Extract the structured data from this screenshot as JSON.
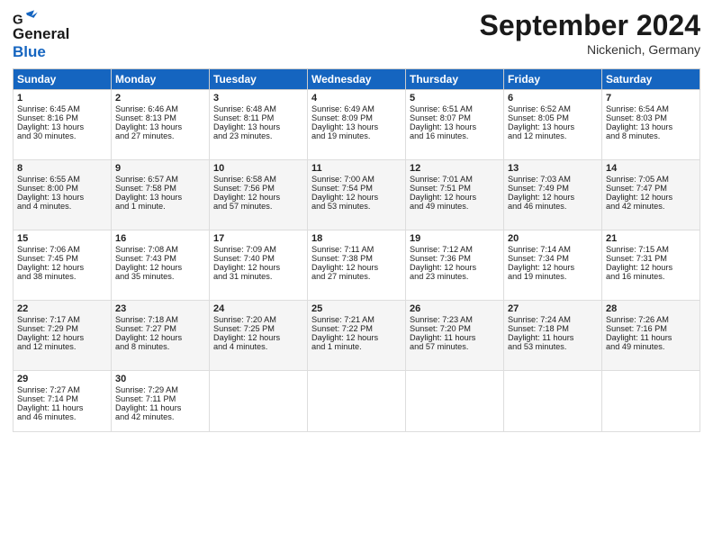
{
  "header": {
    "logo_line1": "General",
    "logo_line2": "Blue",
    "month": "September 2024",
    "location": "Nickenich, Germany"
  },
  "weekdays": [
    "Sunday",
    "Monday",
    "Tuesday",
    "Wednesday",
    "Thursday",
    "Friday",
    "Saturday"
  ],
  "weeks": [
    [
      {
        "day": 1,
        "lines": [
          "Sunrise: 6:45 AM",
          "Sunset: 8:16 PM",
          "Daylight: 13 hours",
          "and 30 minutes."
        ]
      },
      {
        "day": 2,
        "lines": [
          "Sunrise: 6:46 AM",
          "Sunset: 8:13 PM",
          "Daylight: 13 hours",
          "and 27 minutes."
        ]
      },
      {
        "day": 3,
        "lines": [
          "Sunrise: 6:48 AM",
          "Sunset: 8:11 PM",
          "Daylight: 13 hours",
          "and 23 minutes."
        ]
      },
      {
        "day": 4,
        "lines": [
          "Sunrise: 6:49 AM",
          "Sunset: 8:09 PM",
          "Daylight: 13 hours",
          "and 19 minutes."
        ]
      },
      {
        "day": 5,
        "lines": [
          "Sunrise: 6:51 AM",
          "Sunset: 8:07 PM",
          "Daylight: 13 hours",
          "and 16 minutes."
        ]
      },
      {
        "day": 6,
        "lines": [
          "Sunrise: 6:52 AM",
          "Sunset: 8:05 PM",
          "Daylight: 13 hours",
          "and 12 minutes."
        ]
      },
      {
        "day": 7,
        "lines": [
          "Sunrise: 6:54 AM",
          "Sunset: 8:03 PM",
          "Daylight: 13 hours",
          "and 8 minutes."
        ]
      }
    ],
    [
      {
        "day": 8,
        "lines": [
          "Sunrise: 6:55 AM",
          "Sunset: 8:00 PM",
          "Daylight: 13 hours",
          "and 4 minutes."
        ]
      },
      {
        "day": 9,
        "lines": [
          "Sunrise: 6:57 AM",
          "Sunset: 7:58 PM",
          "Daylight: 13 hours",
          "and 1 minute."
        ]
      },
      {
        "day": 10,
        "lines": [
          "Sunrise: 6:58 AM",
          "Sunset: 7:56 PM",
          "Daylight: 12 hours",
          "and 57 minutes."
        ]
      },
      {
        "day": 11,
        "lines": [
          "Sunrise: 7:00 AM",
          "Sunset: 7:54 PM",
          "Daylight: 12 hours",
          "and 53 minutes."
        ]
      },
      {
        "day": 12,
        "lines": [
          "Sunrise: 7:01 AM",
          "Sunset: 7:51 PM",
          "Daylight: 12 hours",
          "and 49 minutes."
        ]
      },
      {
        "day": 13,
        "lines": [
          "Sunrise: 7:03 AM",
          "Sunset: 7:49 PM",
          "Daylight: 12 hours",
          "and 46 minutes."
        ]
      },
      {
        "day": 14,
        "lines": [
          "Sunrise: 7:05 AM",
          "Sunset: 7:47 PM",
          "Daylight: 12 hours",
          "and 42 minutes."
        ]
      }
    ],
    [
      {
        "day": 15,
        "lines": [
          "Sunrise: 7:06 AM",
          "Sunset: 7:45 PM",
          "Daylight: 12 hours",
          "and 38 minutes."
        ]
      },
      {
        "day": 16,
        "lines": [
          "Sunrise: 7:08 AM",
          "Sunset: 7:43 PM",
          "Daylight: 12 hours",
          "and 35 minutes."
        ]
      },
      {
        "day": 17,
        "lines": [
          "Sunrise: 7:09 AM",
          "Sunset: 7:40 PM",
          "Daylight: 12 hours",
          "and 31 minutes."
        ]
      },
      {
        "day": 18,
        "lines": [
          "Sunrise: 7:11 AM",
          "Sunset: 7:38 PM",
          "Daylight: 12 hours",
          "and 27 minutes."
        ]
      },
      {
        "day": 19,
        "lines": [
          "Sunrise: 7:12 AM",
          "Sunset: 7:36 PM",
          "Daylight: 12 hours",
          "and 23 minutes."
        ]
      },
      {
        "day": 20,
        "lines": [
          "Sunrise: 7:14 AM",
          "Sunset: 7:34 PM",
          "Daylight: 12 hours",
          "and 19 minutes."
        ]
      },
      {
        "day": 21,
        "lines": [
          "Sunrise: 7:15 AM",
          "Sunset: 7:31 PM",
          "Daylight: 12 hours",
          "and 16 minutes."
        ]
      }
    ],
    [
      {
        "day": 22,
        "lines": [
          "Sunrise: 7:17 AM",
          "Sunset: 7:29 PM",
          "Daylight: 12 hours",
          "and 12 minutes."
        ]
      },
      {
        "day": 23,
        "lines": [
          "Sunrise: 7:18 AM",
          "Sunset: 7:27 PM",
          "Daylight: 12 hours",
          "and 8 minutes."
        ]
      },
      {
        "day": 24,
        "lines": [
          "Sunrise: 7:20 AM",
          "Sunset: 7:25 PM",
          "Daylight: 12 hours",
          "and 4 minutes."
        ]
      },
      {
        "day": 25,
        "lines": [
          "Sunrise: 7:21 AM",
          "Sunset: 7:22 PM",
          "Daylight: 12 hours",
          "and 1 minute."
        ]
      },
      {
        "day": 26,
        "lines": [
          "Sunrise: 7:23 AM",
          "Sunset: 7:20 PM",
          "Daylight: 11 hours",
          "and 57 minutes."
        ]
      },
      {
        "day": 27,
        "lines": [
          "Sunrise: 7:24 AM",
          "Sunset: 7:18 PM",
          "Daylight: 11 hours",
          "and 53 minutes."
        ]
      },
      {
        "day": 28,
        "lines": [
          "Sunrise: 7:26 AM",
          "Sunset: 7:16 PM",
          "Daylight: 11 hours",
          "and 49 minutes."
        ]
      }
    ],
    [
      {
        "day": 29,
        "lines": [
          "Sunrise: 7:27 AM",
          "Sunset: 7:14 PM",
          "Daylight: 11 hours",
          "and 46 minutes."
        ]
      },
      {
        "day": 30,
        "lines": [
          "Sunrise: 7:29 AM",
          "Sunset: 7:11 PM",
          "Daylight: 11 hours",
          "and 42 minutes."
        ]
      },
      null,
      null,
      null,
      null,
      null
    ]
  ]
}
